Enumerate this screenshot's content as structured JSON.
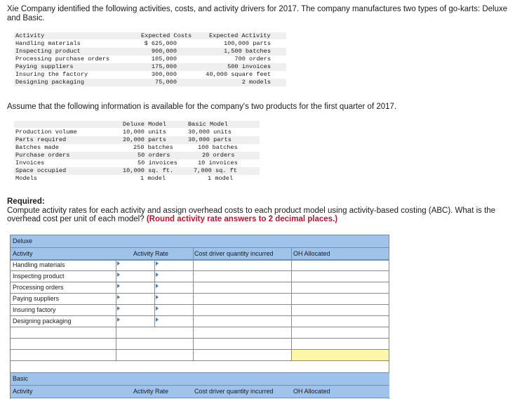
{
  "intro": "Xie Company identified the following activities, costs, and activity drivers for 2017. The company manufactures two types of go-karts: Deluxe and Basic.",
  "activity_table": {
    "headers": [
      "Activity",
      "Expected Costs",
      "Expected Activity"
    ],
    "rows": [
      {
        "activity": "Handling materials",
        "cost": "$ 625,000",
        "driver": "100,000 parts"
      },
      {
        "activity": "Inspecting product",
        "cost": "900,000",
        "driver": "1,500 batches"
      },
      {
        "activity": "Processing purchase orders",
        "cost": "105,000",
        "driver": "700 orders"
      },
      {
        "activity": "Paying suppliers",
        "cost": "175,000",
        "driver": "500 invoices"
      },
      {
        "activity": "Insuring the factory",
        "cost": "300,000",
        "driver": "40,000 square feet"
      },
      {
        "activity": "Designing packaging",
        "cost": "75,000",
        "driver": "2 models"
      }
    ]
  },
  "assume": "Assume that the following information is available for the company's two products for the first quarter of 2017.",
  "product_table": {
    "headers": [
      "",
      "Deluxe Model",
      "Basic Model"
    ],
    "rows": [
      {
        "label": "Production volume",
        "deluxe": "10,000 units",
        "basic": "30,000 units"
      },
      {
        "label": "Parts required",
        "deluxe": "20,000 parts",
        "basic": "30,000 parts"
      },
      {
        "label": "Batches made",
        "deluxe": "250 batches",
        "basic": "100 batches"
      },
      {
        "label": "Purchase orders",
        "deluxe": "50 orders",
        "basic": "20 orders"
      },
      {
        "label": "Invoices",
        "deluxe": "50 invoices",
        "basic": "10 invoices"
      },
      {
        "label": "Space occupied",
        "deluxe": "10,000 sq. ft.",
        "basic": "7,000 sq. ft"
      },
      {
        "label": "Models",
        "deluxe": "1 model",
        "basic": "1 model"
      }
    ]
  },
  "required": {
    "title": "Required:",
    "text": "Compute activity rates for each activity and assign overhead costs to each product model using activity-based costing (ABC). What is the overhead cost per unit of each model?",
    "note": "(Round activity rate answers to 2 decimal places.)"
  },
  "answer_grid": {
    "section_deluxe": "Deluxe",
    "col_activity": "Activity",
    "col_rate": "Activity Rate",
    "col_qty": "Cost driver quantity incurred",
    "col_oh": "OH Allocated",
    "activities": [
      "Handling materials",
      "Inspecting product",
      "Processing orders",
      "Paying suppliers",
      "Insuring factory",
      "Designing packaging"
    ],
    "section_basic": "Basic",
    "basic_col_activity": "Activity",
    "basic_col_rate": "Activity Rate",
    "basic_col_qty": "Cost driver quantity incurred",
    "basic_col_oh": "OH Allocated"
  },
  "colors": {
    "header_blue": "#9fc3ea",
    "highlight_yellow": "#fff7a8",
    "note_red": "#c8102e",
    "arrow_blue": "#4a7ab5"
  }
}
